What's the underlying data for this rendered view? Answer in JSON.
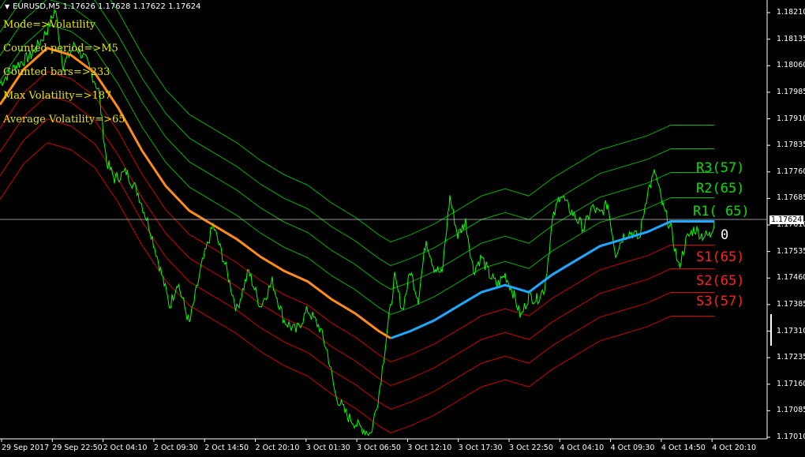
{
  "header": {
    "symbol_label": "EURUSD,M5",
    "ohlc": "1.17626 1.17628 1.17622 1.17624"
  },
  "indicator_info": [
    "Mode=>Volatility",
    "Counted period=>M5",
    "Counted bars=>233",
    "Max Volatility=>187",
    "Average Volatility=>65"
  ],
  "levels": {
    "r3": "R3(57)",
    "r2": "R2(65)",
    "r1": "R1( 65)",
    "zero": "0",
    "s1": "S1(65)",
    "s2": "S2(65)",
    "s3": "S3(57)"
  },
  "current_price": "1.17624",
  "colors": {
    "background": "#000000",
    "price": "#00ff00",
    "ma_orange": "#ff8c1a",
    "ma_blue": "#1ea8ff",
    "upper_bands": "#00c000",
    "lower_bands": "#e00000",
    "level_r": "#00e000",
    "level_s": "#ff2020",
    "info_text": "#e6e600"
  },
  "chart_data": {
    "type": "line",
    "title": "EURUSD,M5 1.17626 1.17628 1.17622 1.17624",
    "y_ticks": [
      "1.18210",
      "1.18135",
      "1.18060",
      "1.17985",
      "1.17910",
      "1.17835",
      "1.17760",
      "1.17685",
      "1.17610",
      "1.17535",
      "1.17460",
      "1.17385",
      "1.17310",
      "1.17235",
      "1.17160",
      "1.17085",
      "1.17010"
    ],
    "ylim": [
      1.1701,
      1.1824
    ],
    "x_ticks": [
      "29 Sep 2017",
      "29 Sep 22:50",
      "2 Oct 04:10",
      "2 Oct 09:30",
      "2 Oct 14:50",
      "2 Oct 20:10",
      "3 Oct 01:30",
      "3 Oct 06:50",
      "3 Oct 12:10",
      "3 Oct 17:30",
      "3 Oct 22:50",
      "4 Oct 04:10",
      "4 Oct 09:30",
      "4 Oct 14:50",
      "4 Oct 20:10"
    ],
    "series": [
      {
        "values": [
          [
            0,
            1.1801
          ],
          [
            20,
            1.1806
          ],
          [
            40,
            1.1809
          ],
          [
            60,
            1.1816
          ],
          [
            70,
            1.1822
          ],
          [
            80,
            1.1806
          ],
          [
            95,
            1.1812
          ],
          [
            110,
            1.1807
          ],
          [
            125,
            1.1799
          ],
          [
            135,
            1.1779
          ],
          [
            145,
            1.1774
          ],
          [
            160,
            1.1776
          ],
          [
            175,
            1.177
          ],
          [
            190,
            1.176
          ],
          [
            205,
            1.1747
          ],
          [
            215,
            1.1738
          ],
          [
            225,
            1.1745
          ],
          [
            240,
            1.1733
          ],
          [
            255,
            1.1749
          ],
          [
            270,
            1.1761
          ],
          [
            285,
            1.175
          ],
          [
            300,
            1.1737
          ],
          [
            315,
            1.1748
          ],
          [
            330,
            1.1738
          ],
          [
            345,
            1.1745
          ],
          [
            360,
            1.1734
          ],
          [
            375,
            1.1731
          ],
          [
            390,
            1.1737
          ],
          [
            405,
            1.1732
          ],
          [
            415,
            1.1725
          ],
          [
            425,
            1.1713
          ],
          [
            440,
            1.1707
          ],
          [
            455,
            1.1704
          ],
          [
            470,
            1.1702
          ],
          [
            480,
            1.1713
          ],
          [
            490,
            1.173
          ],
          [
            500,
            1.1746
          ],
          [
            510,
            1.1737
          ],
          [
            520,
            1.1748
          ],
          [
            530,
            1.174
          ],
          [
            540,
            1.1757
          ],
          [
            550,
            1.1749
          ],
          [
            560,
            1.1747
          ],
          [
            570,
            1.1769
          ],
          [
            580,
            1.1758
          ],
          [
            590,
            1.1762
          ],
          [
            600,
            1.1748
          ],
          [
            610,
            1.1752
          ],
          [
            620,
            1.1747
          ],
          [
            630,
            1.1744
          ],
          [
            640,
            1.1747
          ],
          [
            650,
            1.1742
          ],
          [
            660,
            1.1735
          ],
          [
            670,
            1.1741
          ],
          [
            680,
            1.174
          ],
          [
            690,
            1.1743
          ],
          [
            700,
            1.1762
          ],
          [
            710,
            1.177
          ],
          [
            720,
            1.1766
          ],
          [
            730,
            1.1763
          ],
          [
            740,
            1.176
          ],
          [
            750,
            1.1766
          ],
          [
            760,
            1.1764
          ],
          [
            770,
            1.1767
          ],
          [
            780,
            1.1753
          ],
          [
            790,
            1.1758
          ],
          [
            800,
            1.1759
          ],
          [
            810,
            1.1757
          ],
          [
            820,
            1.177
          ],
          [
            830,
            1.1776
          ],
          [
            840,
            1.1766
          ],
          [
            850,
            1.176
          ],
          [
            860,
            1.1749
          ],
          [
            870,
            1.1757
          ],
          [
            880,
            1.176
          ],
          [
            890,
            1.1758
          ],
          [
            900,
            1.1758
          ],
          [
            905,
            1.1762
          ]
        ]
      },
      {
        "values": [
          [
            0,
            1.1795
          ],
          [
            30,
            1.1805
          ],
          [
            60,
            1.1811
          ],
          [
            90,
            1.1809
          ],
          [
            120,
            1.1804
          ],
          [
            150,
            1.1794
          ],
          [
            180,
            1.1782
          ],
          [
            210,
            1.1772
          ],
          [
            240,
            1.1765
          ],
          [
            270,
            1.1761
          ],
          [
            300,
            1.1757
          ],
          [
            330,
            1.1752
          ],
          [
            360,
            1.1748
          ],
          [
            390,
            1.1745
          ],
          [
            420,
            1.174
          ],
          [
            450,
            1.1736
          ],
          [
            480,
            1.1731
          ],
          [
            495,
            1.1729
          ]
        ]
      },
      {
        "values": [
          [
            495,
            1.1729
          ],
          [
            520,
            1.1731
          ],
          [
            550,
            1.1734
          ],
          [
            580,
            1.1738
          ],
          [
            610,
            1.1742
          ],
          [
            640,
            1.1744
          ],
          [
            670,
            1.1742
          ],
          [
            700,
            1.1747
          ],
          [
            730,
            1.1751
          ],
          [
            760,
            1.1755
          ],
          [
            790,
            1.1757
          ],
          [
            820,
            1.1759
          ],
          [
            850,
            1.1762
          ],
          [
            880,
            1.1762
          ],
          [
            905,
            1.1762
          ]
        ]
      }
    ]
  }
}
